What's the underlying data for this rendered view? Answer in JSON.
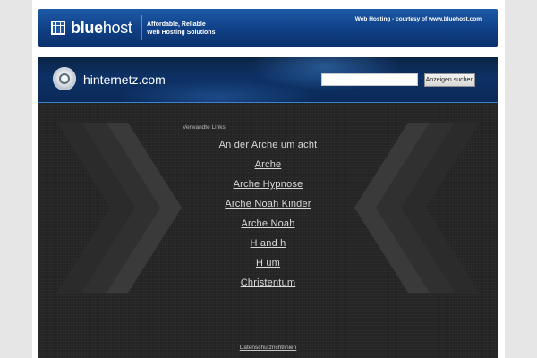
{
  "banner": {
    "brand_bold": "blue",
    "brand_light": "host",
    "tagline_line1": "Affordable, Reliable",
    "tagline_line2": "Web Hosting Solutions",
    "courtesy": "Web Hosting - courtesy of www.bluehost.com"
  },
  "header": {
    "site_name": "hinternetz.com",
    "search": {
      "value": "",
      "placeholder": ""
    },
    "search_button_label": "Anzeigen suchen"
  },
  "main": {
    "related_heading": "Verwandte Links",
    "links": [
      "An der Arche um acht",
      "Arche",
      "Arche Hypnose",
      "Arche Noah Kinder",
      "Arche Noah",
      "H and h",
      "H um",
      "Christentum"
    ],
    "privacy_label": "Datenschutzrichtlinien"
  },
  "colors": {
    "banner_blue": "#1d5aa6",
    "header_blue": "#0d3166",
    "content_bg": "#242424",
    "link_color": "#d8d8d8"
  },
  "icons": [
    "bluehost-grid-icon",
    "site-logo-icon",
    "chevron-left-decoration",
    "chevron-right-decoration"
  ]
}
